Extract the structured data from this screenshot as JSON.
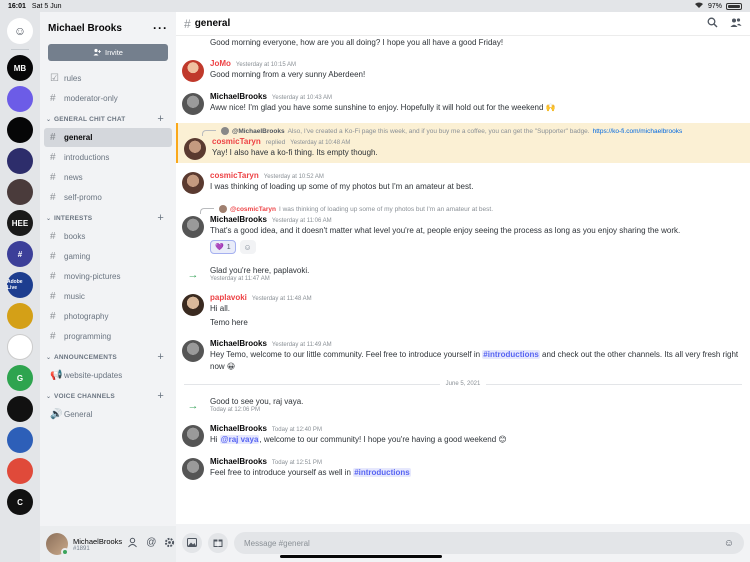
{
  "status_bar": {
    "time": "16:01",
    "date": "Sat 5 Jun",
    "battery": "97%",
    "battery_level": 0.97
  },
  "servers": [
    {
      "label": "",
      "color": "#ffffff",
      "icon": "friends-icon"
    },
    {
      "label": "MB",
      "color": "#060607"
    },
    {
      "label": "",
      "color": "#6c5ce7"
    },
    {
      "label": "",
      "color": "#060607"
    },
    {
      "label": "",
      "color": "#2d2d6b"
    },
    {
      "label": "",
      "color": "#4a3b3b"
    },
    {
      "label": "HEE",
      "color": "#1a1a1a"
    },
    {
      "label": "#",
      "color": "#3c3f99"
    },
    {
      "label": "Adobe Live",
      "color": "#1c3d8f"
    },
    {
      "label": "",
      "color": "#d4a017"
    },
    {
      "label": "",
      "color": "#ffffff"
    },
    {
      "label": "G",
      "color": "#2ea44f"
    },
    {
      "label": "",
      "color": "#111111"
    },
    {
      "label": "",
      "color": "#2d5fb8"
    },
    {
      "label": "",
      "color": "#e04a3a"
    },
    {
      "label": "C",
      "color": "#111111"
    }
  ],
  "guild": {
    "name": "Michael Brooks",
    "invite_label": "Invite"
  },
  "channels_top": [
    {
      "icon": "rules-icon",
      "glyph": "☑",
      "name": "rules"
    },
    {
      "icon": "hash-icon",
      "glyph": "#",
      "name": "moderator-only"
    }
  ],
  "categories": [
    {
      "name": "GENERAL CHIT CHAT",
      "channels": [
        {
          "glyph": "#",
          "name": "general",
          "active": true
        },
        {
          "glyph": "#",
          "name": "introductions"
        },
        {
          "glyph": "#",
          "name": "news"
        },
        {
          "glyph": "#",
          "name": "self-promo"
        }
      ]
    },
    {
      "name": "INTERESTS",
      "channels": [
        {
          "glyph": "#",
          "name": "books"
        },
        {
          "glyph": "#",
          "name": "gaming"
        },
        {
          "glyph": "#",
          "name": "moving-pictures"
        },
        {
          "glyph": "#",
          "name": "music"
        },
        {
          "glyph": "#",
          "name": "photography"
        },
        {
          "glyph": "#",
          "name": "programming"
        }
      ]
    },
    {
      "name": "ANNOUNCEMENTS",
      "channels": [
        {
          "glyph": "📢",
          "name": "website-updates"
        }
      ]
    },
    {
      "name": "VOICE CHANNELS",
      "channels": [
        {
          "glyph": "🔊",
          "name": "General"
        }
      ]
    }
  ],
  "user": {
    "name": "MichaelBrooks",
    "tag": "#1891"
  },
  "channel": {
    "name": "general"
  },
  "messages": {
    "m0": {
      "text": "Good morning everyone, how are you all doing? I hope you all have a good Friday!"
    },
    "m1": {
      "author": "JoMo",
      "ts": "Yesterday at 10:15 AM",
      "text": "Good morning from a very sunny Aberdeen!"
    },
    "m2": {
      "author": "MichaelBrooks",
      "ts": "Yesterday at 10:43 AM",
      "text": "Aww nice! I'm glad you have some sunshine to enjoy. Hopefully it will hold out for the weekend 🙌"
    },
    "m3": {
      "ref_author": "@MichaelBrooks",
      "ref_text": "Also, I've created a Ko-Fi page this week, and if you buy me a coffee, you can get the \"Supporter\" badge.",
      "ref_link": "https://ko-fi.com/michaelbrooks",
      "author": "cosmicTaryn",
      "replied": "replied",
      "ts": "Yesterday at 10:48 AM",
      "text": "Yay! I also have a ko-fi thing. Its empty though."
    },
    "m4": {
      "author": "cosmicTaryn",
      "ts": "Yesterday at 10:52 AM",
      "text": "I was thinking of loading up some of my photos but I'm an amateur at best."
    },
    "m5": {
      "ref_author": "@cosmicTaryn",
      "ref_text": "I was thinking of loading up some of my photos but I'm an amateur at best.",
      "author": "MichaelBrooks",
      "ts": "Yesterday at 11:06 AM",
      "text": "That's a good idea, and it doesn't matter what level you're at, people enjoy seeing the process as long as you enjoy sharing the work.",
      "reaction": "💜",
      "reaction_count": "1"
    },
    "s1": {
      "text": "Glad you're here, paplavoki.",
      "ts": "Yesterday at 11:47 AM"
    },
    "m6": {
      "author": "paplavoki",
      "ts": "Yesterday at 11:48 AM",
      "text1": "Hi all.",
      "text2": "Temo here"
    },
    "m7": {
      "author": "MichaelBrooks",
      "ts": "Yesterday at 11:49 AM",
      "pre": "Hey Temo, welcome to our little community. Feel free to introduce yourself in ",
      "mention": "#introductions",
      "post": " and check out the other channels. Its all very fresh right now 😀"
    },
    "divider": "June 5, 2021",
    "s2": {
      "text": "Good to see you, raj vaya.",
      "ts": "Today at 12:06 PM"
    },
    "m8": {
      "author": "MichaelBrooks",
      "ts": "Today at 12:40 PM",
      "pre": "Hi ",
      "mention": "@raj vaya",
      "post": ", welcome to our community! I hope you're having a good weekend 😊"
    },
    "m9": {
      "author": "MichaelBrooks",
      "ts": "Today at 12:51 PM",
      "pre": "Feel free to introduce yourself as well in ",
      "mention": "#introductions"
    }
  },
  "composer": {
    "placeholder": "Message #general"
  },
  "colors": {
    "accent": "#5865f2",
    "mention_red": "#ed4245",
    "online": "#3ba55d",
    "highlight": "#fbf0d4"
  }
}
